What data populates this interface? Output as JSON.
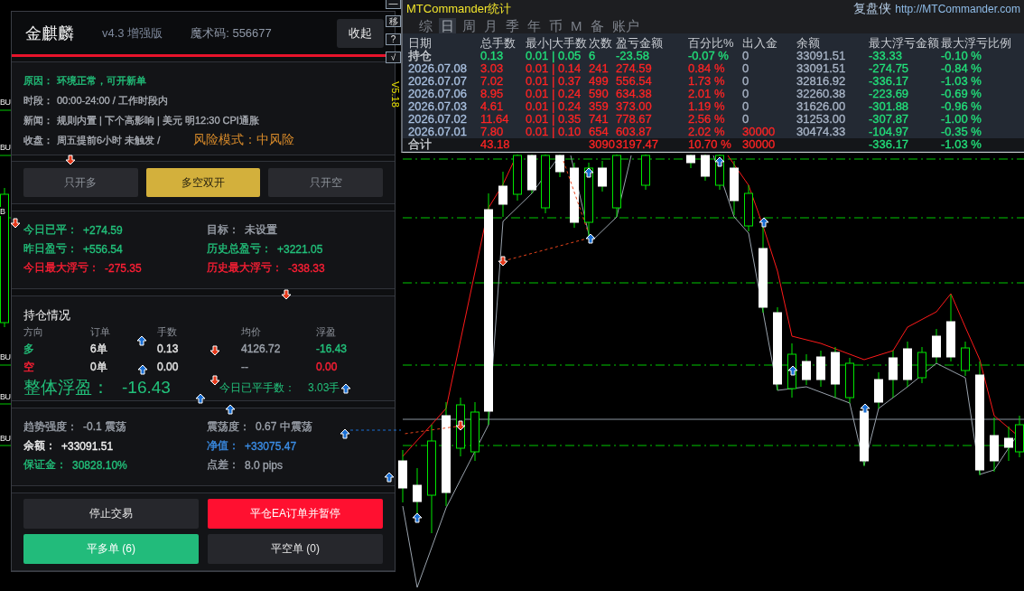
{
  "chart": {
    "edge_labels": [
      "BU",
      "BU",
      "B",
      "BU",
      "BU",
      "BU"
    ]
  },
  "panel": {
    "title": "金麒麟",
    "version": "v4.3 增强版",
    "magic": "魔术码: 556677",
    "collapse_button": "收起",
    "info": [
      {
        "label": "原因：",
        "value": "环境正常，可开新单",
        "color": "#22c07a"
      },
      {
        "label": "时段：",
        "value": "00:00-24:00 / 工作时段内",
        "color": "#a9adb4"
      },
      {
        "label": "新闻：",
        "value": "规则内置 | 下个高影响 | 美元 明12:30 CPI通胀",
        "color": "#a9adb4"
      },
      {
        "label": "收盘：",
        "value": "周五提前6小时 未触发 /",
        "color": "#a9adb4"
      }
    ],
    "risk_mode": "风险模式：中风险",
    "modes": [
      {
        "label": "只开多",
        "selected": false
      },
      {
        "label": "多空双开",
        "selected": true
      },
      {
        "label": "只开空",
        "selected": false
      }
    ],
    "profit": [
      {
        "label": "今日已平：",
        "value": "+274.59",
        "color": "#22c07a"
      },
      {
        "label": "目标：",
        "value": "未设置",
        "color": "#9ca2ab"
      },
      {
        "label": "昨日盈亏：",
        "value": "+556.54",
        "color": "#22c07a"
      },
      {
        "label": "历史总盈亏：",
        "value": "+3221.05",
        "color": "#22c07a"
      },
      {
        "label": "今日最大浮亏：",
        "value": "-275.35",
        "color": "#ff1f35"
      },
      {
        "label": "历史最大浮亏：",
        "value": "-338.33",
        "color": "#ff1f35"
      }
    ],
    "positions": {
      "title": "持仓情况",
      "columns": [
        "方向",
        "订单",
        "手数",
        "均价",
        "浮盈"
      ],
      "rows": [
        {
          "direction": "多",
          "orders": "6单",
          "lots": "0.13",
          "avg_price": "4126.72",
          "floating": "-16.43",
          "color": "#22c07a"
        },
        {
          "direction": "空",
          "orders": "0单",
          "lots": "0.00",
          "avg_price": "--",
          "floating": "0.00",
          "color": "#ff1f35"
        }
      ],
      "total": {
        "label": "整体浮盈：",
        "value": "-16.43"
      },
      "closed_lots": {
        "label": "今日已平手数：",
        "value": "3.03手"
      }
    },
    "account": [
      {
        "label": "趋势强度：",
        "value": "-0.1 震荡",
        "color": "#9ca2ab"
      },
      {
        "label": "震荡度：",
        "value": "0.67 中震荡",
        "color": "#9ca2ab"
      },
      {
        "label": "余额：",
        "value": "+33091.51",
        "color": "#f0f0f0"
      },
      {
        "label": "净值：",
        "value": "+33075.47",
        "color": "#3b8de6"
      },
      {
        "label": "保证金：",
        "value": "30828.10%",
        "color": "#22c07a"
      },
      {
        "label": "点差：",
        "value": "8.0 pips",
        "color": "#9ca2ab"
      }
    ],
    "actions": [
      {
        "label": "停止交易",
        "kind": "neutral"
      },
      {
        "label": "平仓EA订单并暂停",
        "kind": "danger"
      },
      {
        "label": "平多单 (6)",
        "kind": "long"
      },
      {
        "label": "平空单 (0)",
        "kind": "neutral"
      }
    ]
  },
  "side_tools": [
    "—",
    "移",
    "?",
    "√"
  ],
  "version_tag": "V5.18",
  "stats_window": {
    "title": "MTCommander统计",
    "brand": "复盘侠",
    "url": "http://MTCommander.com",
    "tabs": [
      {
        "label": "综",
        "selected": false
      },
      {
        "label": "日",
        "selected": true
      },
      {
        "label": "周",
        "selected": false
      },
      {
        "label": "月",
        "selected": false
      },
      {
        "label": "季",
        "selected": false
      },
      {
        "label": "年",
        "selected": false
      },
      {
        "label": "币",
        "selected": false
      },
      {
        "label": "M",
        "selected": false
      },
      {
        "label": "备",
        "selected": false
      },
      {
        "label": "账户",
        "selected": false
      }
    ],
    "columns": [
      "日期",
      "总手数",
      "最小|大手数",
      "次数",
      "盈亏金额",
      "百分比%",
      "出入金",
      "余额",
      "最大浮亏金额",
      "最大浮亏比例"
    ],
    "rows": [
      {
        "kind": "position",
        "cells": [
          {
            "text": "持仓",
            "color": "#cfd3d8"
          },
          {
            "text": "0.13",
            "color": "#22e07a"
          },
          {
            "text": "0.01 | 0.05",
            "color": "#22e07a"
          },
          {
            "text": "6",
            "color": "#22e07a"
          },
          {
            "text": "-23.58",
            "color": "#22e07a"
          },
          {
            "text": "-0.07 %",
            "color": "#22e07a"
          },
          {
            "text": "0",
            "color": "#aab6c8"
          },
          {
            "text": "33091.51",
            "color": "#aab6c8"
          },
          {
            "text": "-33.33",
            "color": "#22e07a"
          },
          {
            "text": "-0.10 %",
            "color": "#22e07a"
          }
        ]
      },
      {
        "kind": "day",
        "cells": [
          {
            "text": "2026.07.08",
            "color": "#a9c0e0"
          },
          {
            "text": "3.03",
            "color": "#ff2424"
          },
          {
            "text": "0.01 | 0.14",
            "color": "#ff2424"
          },
          {
            "text": "241",
            "color": "#ff2424"
          },
          {
            "text": "274.59",
            "color": "#ff2424"
          },
          {
            "text": "0.84 %",
            "color": "#ff2424"
          },
          {
            "text": "0",
            "color": "#aab6c8"
          },
          {
            "text": "33091.51",
            "color": "#aab6c8"
          },
          {
            "text": "-274.75",
            "color": "#22e07a"
          },
          {
            "text": "-0.84 %",
            "color": "#22e07a"
          }
        ]
      },
      {
        "kind": "day",
        "cells": [
          {
            "text": "2026.07.07",
            "color": "#a9c0e0"
          },
          {
            "text": "7.02",
            "color": "#ff2424"
          },
          {
            "text": "0.01 | 0.37",
            "color": "#ff2424"
          },
          {
            "text": "499",
            "color": "#ff2424"
          },
          {
            "text": "556.54",
            "color": "#ff2424"
          },
          {
            "text": "1.73 %",
            "color": "#ff2424"
          },
          {
            "text": "0",
            "color": "#aab6c8"
          },
          {
            "text": "32816.92",
            "color": "#aab6c8"
          },
          {
            "text": "-336.17",
            "color": "#22e07a"
          },
          {
            "text": "-1.03 %",
            "color": "#22e07a"
          }
        ]
      },
      {
        "kind": "day",
        "cells": [
          {
            "text": "2026.07.06",
            "color": "#a9c0e0"
          },
          {
            "text": "8.95",
            "color": "#ff2424"
          },
          {
            "text": "0.01 | 0.24",
            "color": "#ff2424"
          },
          {
            "text": "590",
            "color": "#ff2424"
          },
          {
            "text": "634.38",
            "color": "#ff2424"
          },
          {
            "text": "2.01 %",
            "color": "#ff2424"
          },
          {
            "text": "0",
            "color": "#aab6c8"
          },
          {
            "text": "32260.38",
            "color": "#aab6c8"
          },
          {
            "text": "-223.69",
            "color": "#22e07a"
          },
          {
            "text": "-0.69 %",
            "color": "#22e07a"
          }
        ]
      },
      {
        "kind": "day",
        "cells": [
          {
            "text": "2026.07.03",
            "color": "#a9c0e0"
          },
          {
            "text": "4.61",
            "color": "#ff2424"
          },
          {
            "text": "0.01 | 0.24",
            "color": "#ff2424"
          },
          {
            "text": "359",
            "color": "#ff2424"
          },
          {
            "text": "373.00",
            "color": "#ff2424"
          },
          {
            "text": "1.19 %",
            "color": "#ff2424"
          },
          {
            "text": "0",
            "color": "#aab6c8"
          },
          {
            "text": "31626.00",
            "color": "#aab6c8"
          },
          {
            "text": "-301.88",
            "color": "#22e07a"
          },
          {
            "text": "-0.96 %",
            "color": "#22e07a"
          }
        ]
      },
      {
        "kind": "day",
        "cells": [
          {
            "text": "2026.07.02",
            "color": "#a9c0e0"
          },
          {
            "text": "11.64",
            "color": "#ff2424"
          },
          {
            "text": "0.01 | 0.35",
            "color": "#ff2424"
          },
          {
            "text": "741",
            "color": "#ff2424"
          },
          {
            "text": "778.67",
            "color": "#ff2424"
          },
          {
            "text": "2.56 %",
            "color": "#ff2424"
          },
          {
            "text": "0",
            "color": "#aab6c8"
          },
          {
            "text": "31253.00",
            "color": "#aab6c8"
          },
          {
            "text": "-307.87",
            "color": "#22e07a"
          },
          {
            "text": "-1.00 %",
            "color": "#22e07a"
          }
        ]
      },
      {
        "kind": "day",
        "cells": [
          {
            "text": "2026.07.01",
            "color": "#a9c0e0"
          },
          {
            "text": "7.80",
            "color": "#ff2424"
          },
          {
            "text": "0.01 | 0.10",
            "color": "#ff2424"
          },
          {
            "text": "654",
            "color": "#ff2424"
          },
          {
            "text": "603.87",
            "color": "#ff2424"
          },
          {
            "text": "2.02 %",
            "color": "#ff2424"
          },
          {
            "text": "30000",
            "color": "#ff2424"
          },
          {
            "text": "30474.33",
            "color": "#aab6c8"
          },
          {
            "text": "-104.97",
            "color": "#22e07a"
          },
          {
            "text": "-0.35 %",
            "color": "#22e07a"
          }
        ]
      },
      {
        "kind": "total",
        "cells": [
          {
            "text": "合计",
            "color": "#cfd3d8"
          },
          {
            "text": "43.18",
            "color": "#ff2424"
          },
          null,
          {
            "text": "3090",
            "color": "#ff2424"
          },
          {
            "text": "3197.47",
            "color": "#ff2424"
          },
          {
            "text": "10.70 %",
            "color": "#ff2424"
          },
          {
            "text": "30000",
            "color": "#ff2424"
          },
          null,
          {
            "text": "-336.17",
            "color": "#22e07a"
          },
          {
            "text": "-1.03 %",
            "color": "#22e07a"
          }
        ]
      }
    ]
  }
}
